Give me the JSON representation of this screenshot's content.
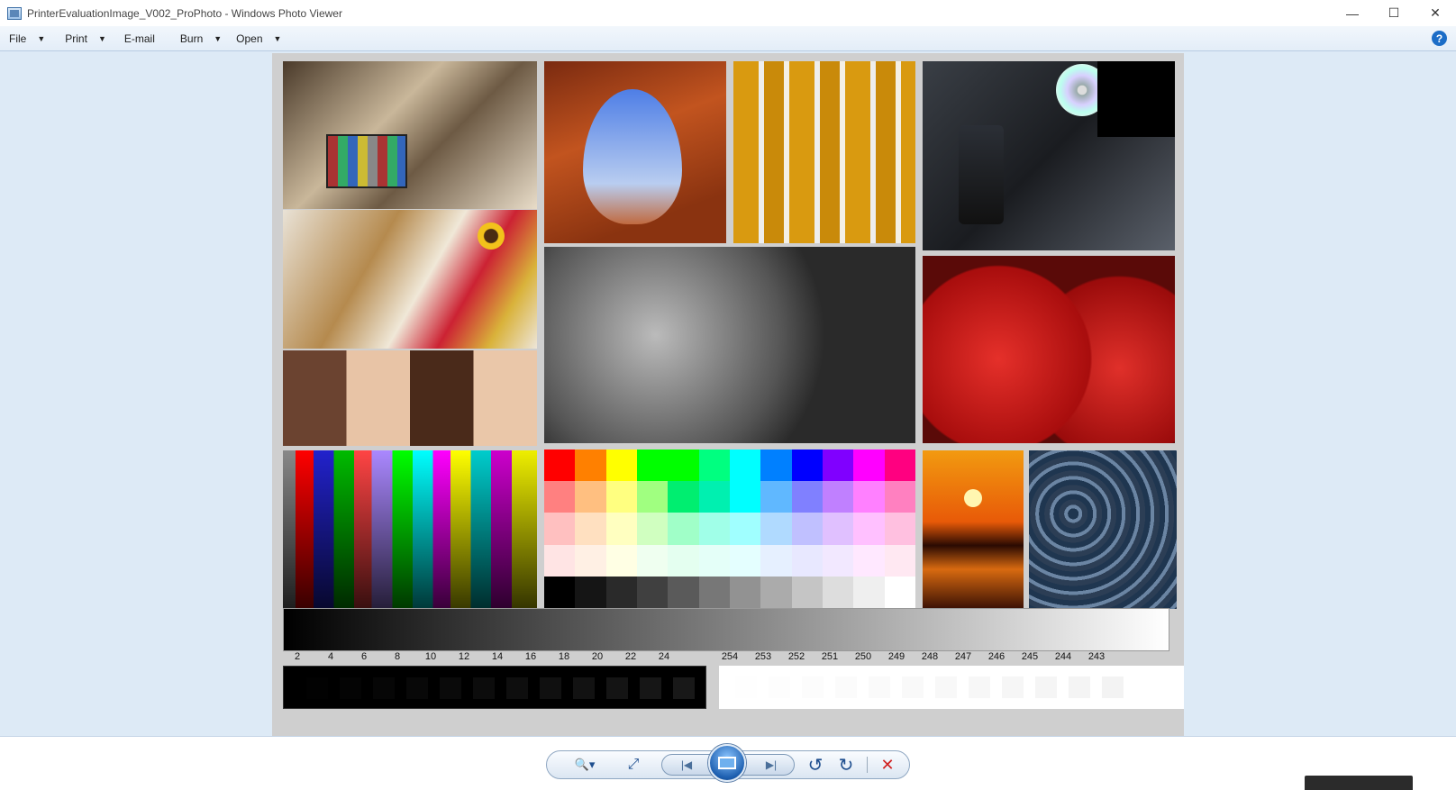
{
  "window": {
    "title": "PrinterEvaluationImage_V002_ProPhoto - Windows Photo Viewer",
    "icons": {
      "app": "photo-viewer-icon",
      "minimize": "minimize-icon",
      "maximize": "maximize-icon",
      "close": "close-icon"
    }
  },
  "menu": {
    "items": [
      {
        "label": "File",
        "has_dropdown": true
      },
      {
        "label": "Print",
        "has_dropdown": true
      },
      {
        "label": "E-mail",
        "has_dropdown": false
      },
      {
        "label": "Burn",
        "has_dropdown": true
      },
      {
        "label": "Open",
        "has_dropdown": true
      }
    ],
    "help_glyph": "?"
  },
  "image": {
    "dark_step_labels": [
      "2",
      "4",
      "6",
      "8",
      "10",
      "12",
      "14",
      "16",
      "18",
      "20",
      "22",
      "24"
    ],
    "light_step_labels": [
      "254",
      "253",
      "252",
      "251",
      "250",
      "249",
      "248",
      "247",
      "246",
      "245",
      "244",
      "243"
    ],
    "color_patches": [
      [
        "#ff0000",
        "#ff8000",
        "#ffff00",
        "#00ff00",
        "#00ff00",
        "#00ff80",
        "#00ffff",
        "#0080ff",
        "#0000ff",
        "#8000ff",
        "#ff00ff",
        "#ff0080"
      ],
      [
        "#ff8080",
        "#ffbf80",
        "#ffff80",
        "#a0ff80",
        "#00ee70",
        "#00f0b0",
        "#00ffff",
        "#60b8ff",
        "#8080ff",
        "#c080ff",
        "#ff80ff",
        "#ff80c0"
      ],
      [
        "#ffc0c0",
        "#ffe0c0",
        "#ffffc0",
        "#d0ffc0",
        "#a0ffc8",
        "#a0ffe8",
        "#a0ffff",
        "#b0daff",
        "#c0c0ff",
        "#e0c0ff",
        "#ffc0ff",
        "#ffc0e0"
      ],
      [
        "#ffe4e4",
        "#fff0e4",
        "#ffffe4",
        "#effff0",
        "#e4fff0",
        "#e4fff8",
        "#e4ffff",
        "#e6f0ff",
        "#e8e8ff",
        "#f2e8ff",
        "#ffe8ff",
        "#ffe8f2"
      ],
      [
        "#000000",
        "#151515",
        "#2a2a2a",
        "#404040",
        "#5a5a5a",
        "#777777",
        "#929292",
        "#ababab",
        "#c5c5c5",
        "#dddddd",
        "#efefef",
        "#ffffff"
      ]
    ]
  },
  "toolbar": {
    "buttons": [
      "zoom",
      "fit",
      "previous",
      "slideshow",
      "next",
      "rotate-ccw",
      "rotate-cw",
      "delete"
    ],
    "glyphs": {
      "zoom": "🔍▾",
      "fit": "⤢",
      "previous": "|◀",
      "next": "▶|",
      "rotate_ccw": "↺",
      "rotate_cw": "↻",
      "delete": "✕"
    },
    "delete_color": "#d02020"
  }
}
